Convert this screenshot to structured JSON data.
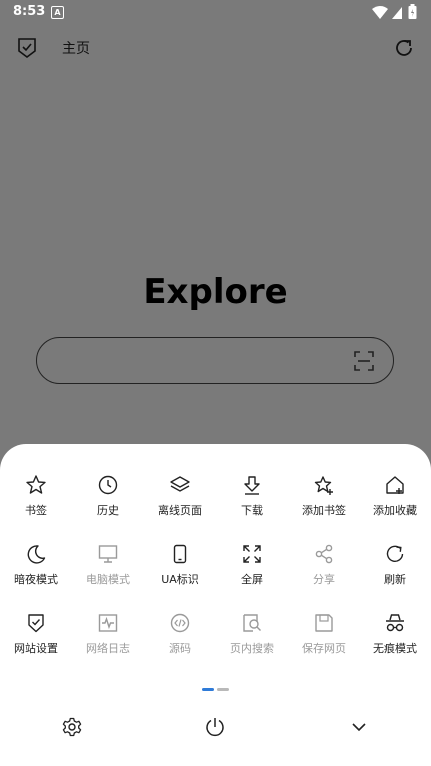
{
  "status": {
    "time": "8:53",
    "notif_letter": "A"
  },
  "topbar": {
    "title": "主页"
  },
  "hero": {
    "title": "Explore"
  },
  "search": {
    "placeholder": ""
  },
  "menu": {
    "rows": [
      [
        {
          "label": "书签",
          "icon": "star-icon",
          "dim": false
        },
        {
          "label": "历史",
          "icon": "clock-icon",
          "dim": false
        },
        {
          "label": "离线页面",
          "icon": "layers-icon",
          "dim": false
        },
        {
          "label": "下载",
          "icon": "download-icon",
          "dim": false
        },
        {
          "label": "添加书签",
          "icon": "star-plus-icon",
          "dim": false
        },
        {
          "label": "添加收藏",
          "icon": "home-plus-icon",
          "dim": false
        }
      ],
      [
        {
          "label": "暗夜模式",
          "icon": "moon-icon",
          "dim": false
        },
        {
          "label": "电脑模式",
          "icon": "monitor-icon",
          "dim": true
        },
        {
          "label": "UA标识",
          "icon": "phone-icon",
          "dim": false
        },
        {
          "label": "全屏",
          "icon": "fullscreen-icon",
          "dim": false
        },
        {
          "label": "分享",
          "icon": "share-icon",
          "dim": true
        },
        {
          "label": "刷新",
          "icon": "refresh-icon",
          "dim": false
        }
      ],
      [
        {
          "label": "网站设置",
          "icon": "shield-check-icon",
          "dim": false
        },
        {
          "label": "网络日志",
          "icon": "pulse-icon",
          "dim": true
        },
        {
          "label": "源码",
          "icon": "code-icon",
          "dim": true
        },
        {
          "label": "页内搜索",
          "icon": "page-search-icon",
          "dim": true
        },
        {
          "label": "保存网页",
          "icon": "save-icon",
          "dim": true
        },
        {
          "label": "无痕模式",
          "icon": "incognito-icon",
          "dim": false
        }
      ]
    ]
  },
  "colors": {
    "accent": "#2f7bd8",
    "dot_inactive": "#b9b9b9",
    "icon": "#222222",
    "icon_dim": "#9a9a9a",
    "overlay": "#7a7a7a"
  }
}
